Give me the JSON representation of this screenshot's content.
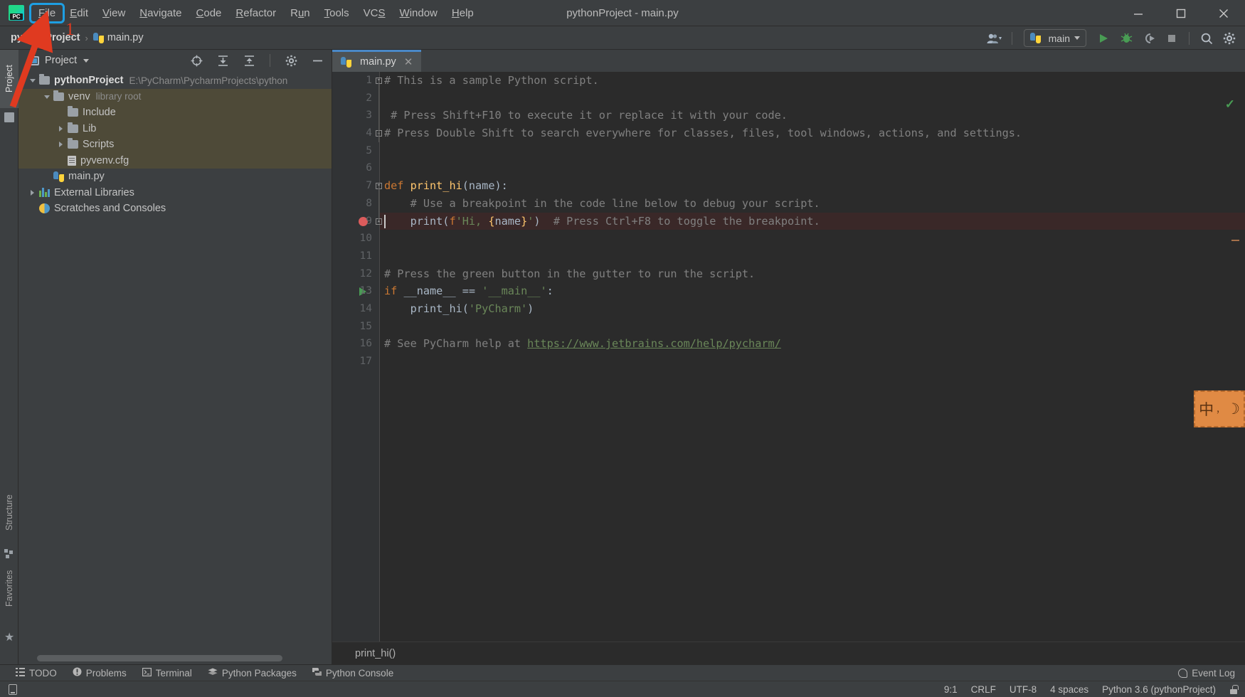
{
  "window": {
    "title": "pythonProject - main.py",
    "app_icon": "pycharm-logo",
    "minimize": "—",
    "maximize": "□",
    "close": "✕"
  },
  "menubar": {
    "items": [
      {
        "label": "File",
        "mnemonic": "F",
        "highlighted": true
      },
      {
        "label": "Edit",
        "mnemonic": "E",
        "highlighted": false
      },
      {
        "label": "View",
        "mnemonic": "V",
        "highlighted": false
      },
      {
        "label": "Navigate",
        "mnemonic": "N",
        "highlighted": false
      },
      {
        "label": "Code",
        "mnemonic": "C",
        "highlighted": false
      },
      {
        "label": "Refactor",
        "mnemonic": "R",
        "highlighted": false
      },
      {
        "label": "Run",
        "mnemonic": "u",
        "highlighted": false
      },
      {
        "label": "Tools",
        "mnemonic": "T",
        "highlighted": false
      },
      {
        "label": "VCS",
        "mnemonic": "S",
        "highlighted": false
      },
      {
        "label": "Window",
        "mnemonic": "W",
        "highlighted": false
      },
      {
        "label": "Help",
        "mnemonic": "H",
        "highlighted": false
      }
    ]
  },
  "annotation": {
    "number": "1",
    "color": "#e03a20",
    "highlight_color": "#1e9fe3"
  },
  "navbar": {
    "breadcrumb": {
      "project": "pythonProject",
      "separator": "›",
      "file": "main.py"
    },
    "right": {
      "run_config": "main",
      "actions": [
        "run-button",
        "debug-button",
        "run-coverage-button",
        "stop-button",
        "search-everywhere-button",
        "settings-button"
      ]
    }
  },
  "toolstrip": {
    "left_tabs": [
      {
        "label": "Project",
        "active": true
      },
      {
        "label": "Structure",
        "active": false
      },
      {
        "label": "Favorites",
        "active": false
      }
    ]
  },
  "project_panel": {
    "title": "Project",
    "toolbar_icons": [
      "locate-icon",
      "expand-all-icon",
      "collapse-all-icon",
      "settings-icon",
      "hide-icon"
    ],
    "tree": [
      {
        "indent": 0,
        "arrow": "down",
        "icon": "folder",
        "label": "pythonProject",
        "bold": true,
        "sub": "E:\\PyCharm\\PycharmProjects\\python",
        "selected": false
      },
      {
        "indent": 1,
        "arrow": "down",
        "icon": "folder",
        "label": "venv",
        "bold": false,
        "sub": "library root",
        "selected": true
      },
      {
        "indent": 2,
        "arrow": "none",
        "icon": "folder",
        "label": "Include",
        "bold": false,
        "sub": "",
        "selected": true
      },
      {
        "indent": 2,
        "arrow": "right",
        "icon": "folder",
        "label": "Lib",
        "bold": false,
        "sub": "",
        "selected": true
      },
      {
        "indent": 2,
        "arrow": "right",
        "icon": "folder",
        "label": "Scripts",
        "bold": false,
        "sub": "",
        "selected": true
      },
      {
        "indent": 2,
        "arrow": "none",
        "icon": "cfg",
        "label": "pyvenv.cfg",
        "bold": false,
        "sub": "",
        "selected": true
      },
      {
        "indent": 1,
        "arrow": "none",
        "icon": "python",
        "label": "main.py",
        "bold": false,
        "sub": "",
        "selected": false
      },
      {
        "indent": 0,
        "arrow": "right",
        "icon": "libs",
        "label": "External Libraries",
        "bold": false,
        "sub": "",
        "selected": false
      },
      {
        "indent": 0,
        "arrow": "none",
        "icon": "scratch",
        "label": "Scratches and Consoles",
        "bold": false,
        "sub": "",
        "selected": false
      }
    ]
  },
  "editor": {
    "tab": {
      "label": "main.py",
      "icon": "python-file-icon",
      "close": "✕"
    },
    "inspection_status": "✓",
    "breadcrumb_bottom": "print_hi()",
    "lines": [
      {
        "n": "1",
        "marker": "none",
        "fold": "open",
        "html": "<span class='c-com'># This is a sample Python script.</span>"
      },
      {
        "n": "2",
        "marker": "none",
        "fold": "none",
        "html": ""
      },
      {
        "n": "3",
        "marker": "none",
        "fold": "none",
        "html": "<span class='c-com'> # Press Shift+F10 to execute it or replace it with your code.</span>"
      },
      {
        "n": "4",
        "marker": "none",
        "fold": "close",
        "html": "<span class='c-com'># Press Double Shift to search everywhere for classes, files, tool windows, actions, and settings.</span>"
      },
      {
        "n": "5",
        "marker": "none",
        "fold": "none",
        "html": ""
      },
      {
        "n": "6",
        "marker": "none",
        "fold": "none",
        "html": ""
      },
      {
        "n": "7",
        "marker": "none",
        "fold": "open",
        "html": "<span class='c-kw'>def</span> <span class='c-fn'>print_hi</span><span class='c-txt'>(name):</span>"
      },
      {
        "n": "8",
        "marker": "none",
        "fold": "none",
        "html": "    <span class='c-com'># Use a breakpoint in the code line below to debug your script.</span>"
      },
      {
        "n": "9",
        "marker": "breakpoint",
        "fold": "close",
        "html": "    <span class='c-txt'>print(</span><span class='c-kw'>f</span><span class='c-str'>'Hi, </span><span class='c-brc'>{</span><span class='c-txt'>name</span><span class='c-brc'>}</span><span class='c-str'>'</span><span class='c-txt'>)</span>  <span class='c-com'># Press Ctrl+F8 to toggle the breakpoint.</span>"
      },
      {
        "n": "10",
        "marker": "none",
        "fold": "none",
        "html": ""
      },
      {
        "n": "11",
        "marker": "none",
        "fold": "none",
        "html": ""
      },
      {
        "n": "12",
        "marker": "none",
        "fold": "none",
        "html": "<span class='c-com'># Press the green button in the gutter to run the script.</span>"
      },
      {
        "n": "13",
        "marker": "run",
        "fold": "none",
        "html": "<span class='c-kw'>if</span> <span class='c-id'>__name__</span> <span class='c-txt'>==</span> <span class='c-str'>'__main__'</span><span class='c-txt'>:</span>"
      },
      {
        "n": "14",
        "marker": "none",
        "fold": "none",
        "html": "    <span class='c-txt'>print_hi(</span><span class='c-str'>'PyCharm'</span><span class='c-txt'>)</span>"
      },
      {
        "n": "15",
        "marker": "none",
        "fold": "none",
        "html": ""
      },
      {
        "n": "16",
        "marker": "none",
        "fold": "none",
        "html": "<span class='c-com'># See PyCharm help at </span><span class='c-link'>https://www.jetbrains.com/help/pycharm/</span>"
      },
      {
        "n": "17",
        "marker": "none",
        "fold": "none",
        "html": ""
      }
    ]
  },
  "ime_badge": {
    "glyphs": "中",
    "marks": "，",
    "moon": "☽"
  },
  "toolwindow_bar": {
    "items": [
      {
        "label": "TODO",
        "icon": "list-icon"
      },
      {
        "label": "Problems",
        "icon": "problems-icon"
      },
      {
        "label": "Terminal",
        "icon": "terminal-icon"
      },
      {
        "label": "Python Packages",
        "icon": "packages-icon"
      },
      {
        "label": "Python Console",
        "icon": "python-console-icon"
      }
    ],
    "event_log": "Event Log"
  },
  "statusbar": {
    "left_icon": "toggle-toolwindows-icon",
    "items": [
      "9:1",
      "CRLF",
      "UTF-8",
      "4 spaces",
      "Python 3.6 (pythonProject)"
    ],
    "lock_icon": "unlocked-icon"
  }
}
